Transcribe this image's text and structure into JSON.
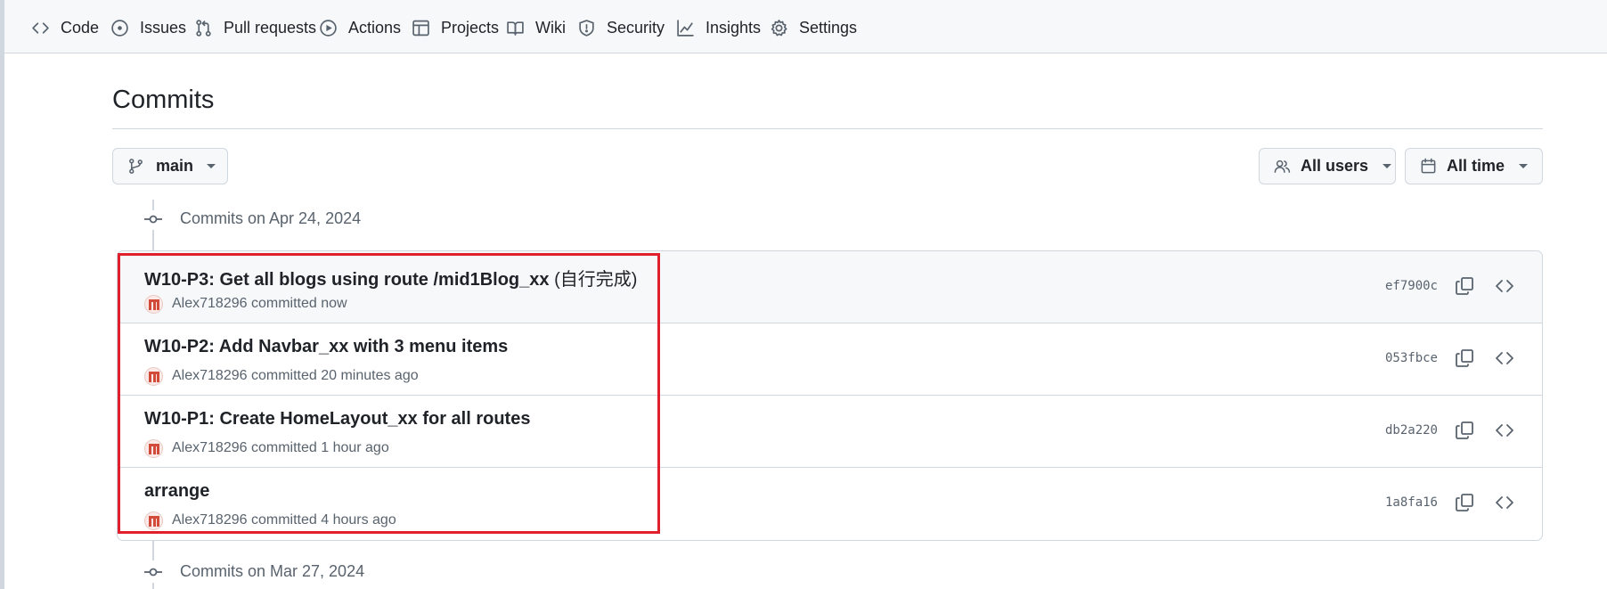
{
  "nav": {
    "items": [
      {
        "label": "Code",
        "icon": "code-icon"
      },
      {
        "label": "Issues",
        "icon": "issue-opened-icon"
      },
      {
        "label": "Pull requests",
        "icon": "git-pull-request-icon"
      },
      {
        "label": "Actions",
        "icon": "play-icon"
      },
      {
        "label": "Projects",
        "icon": "table-icon"
      },
      {
        "label": "Wiki",
        "icon": "book-icon"
      },
      {
        "label": "Security",
        "icon": "shield-icon"
      },
      {
        "label": "Insights",
        "icon": "graph-icon"
      },
      {
        "label": "Settings",
        "icon": "gear-icon"
      }
    ]
  },
  "page": {
    "title": "Commits"
  },
  "filters": {
    "branch": "main",
    "users": "All users",
    "time": "All time"
  },
  "groups": [
    {
      "heading": "Commits on Apr 24, 2024",
      "commits": [
        {
          "title": "W10-P3: Get all blogs using route /mid1Blog_xx",
          "title_suffix": "(自行完成)",
          "author": "Alex718296",
          "action": "committed",
          "time": "now",
          "sha": "ef7900c"
        },
        {
          "title": "W10-P2: Add Navbar_xx with 3 menu items",
          "title_suffix": "",
          "author": "Alex718296",
          "action": "committed",
          "time": "20 minutes ago",
          "sha": "053fbce"
        },
        {
          "title": "W10-P1: Create HomeLayout_xx for all routes",
          "title_suffix": "",
          "author": "Alex718296",
          "action": "committed",
          "time": "1 hour ago",
          "sha": "db2a220"
        },
        {
          "title": "arrange",
          "title_suffix": "",
          "author": "Alex718296",
          "action": "committed",
          "time": "4 hours ago",
          "sha": "1a8fa16"
        }
      ]
    },
    {
      "heading": "Commits on Mar 27, 2024",
      "commits": []
    }
  ],
  "colors": {
    "highlight": "#e0202c",
    "nav_bg": "#f6f8fa",
    "border": "#d0d7de",
    "muted_text": "#59636e"
  }
}
